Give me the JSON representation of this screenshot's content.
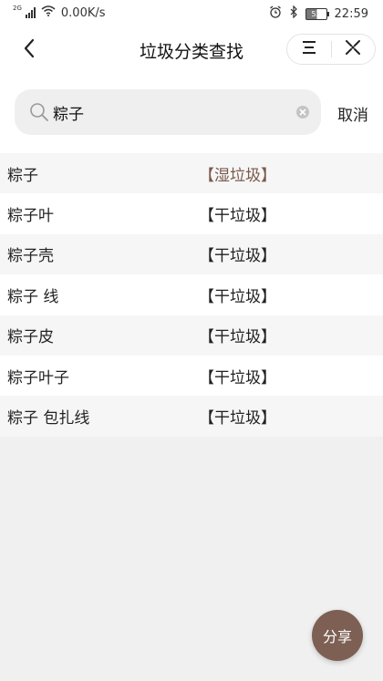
{
  "status_bar": {
    "network_type": "2G",
    "speed": "0.00K/s",
    "battery": "52",
    "time": "22:59"
  },
  "header": {
    "title": "垃圾分类查找"
  },
  "search": {
    "value": "粽子",
    "placeholder": "",
    "cancel_label": "取消"
  },
  "results": [
    {
      "name": "粽子",
      "type": "【湿垃圾】"
    },
    {
      "name": "粽子叶",
      "type": "【干垃圾】"
    },
    {
      "name": "粽子壳",
      "type": "【干垃圾】"
    },
    {
      "name": "粽子 线",
      "type": "【干垃圾】"
    },
    {
      "name": "粽子皮",
      "type": "【干垃圾】"
    },
    {
      "name": "粽子叶子",
      "type": "【干垃圾】"
    },
    {
      "name": "粽子 包扎线",
      "type": "【干垃圾】"
    }
  ],
  "share": {
    "label": "分享"
  },
  "colors": {
    "accent": "#7d5f54",
    "wet_text": "#7a5a4d"
  },
  "icons": {
    "back": "chevron-left-icon",
    "menu": "menu-icon",
    "close": "close-icon",
    "search": "search-icon",
    "clear": "clear-icon",
    "wifi": "wifi-icon",
    "alarm": "alarm-icon",
    "bluetooth": "bluetooth-icon"
  }
}
